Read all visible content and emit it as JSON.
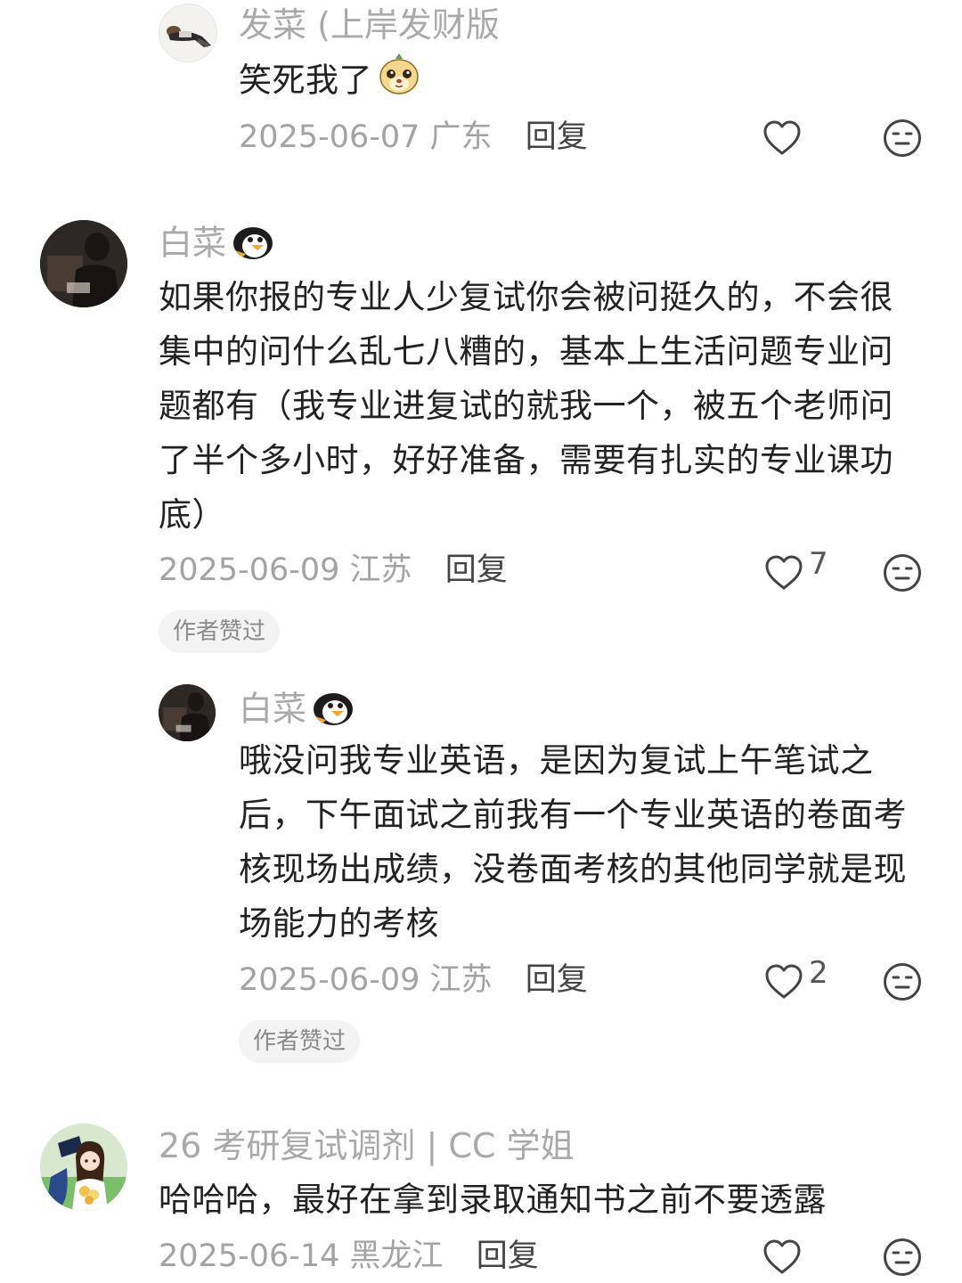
{
  "comments": [
    {
      "username": "发菜 (上岸发财版",
      "content": "笑死我了",
      "date": "2025-06-07",
      "location": "广东",
      "reply_label": "回复",
      "like_count": "",
      "emoji": "cute-sticker-icon"
    },
    {
      "username": "白菜",
      "content": "如果你报的专业人少复试你会被问挺久的，不会很集中的问什么乱七八糟的，基本上生活问题专业问题都有（我专业进复试的就我一个，被五个老师问了半个多小时，好好准备，需要有扎实的专业课功底）",
      "date": "2025-06-09",
      "location": "江苏",
      "reply_label": "回复",
      "like_count": "7",
      "badge": "作者赞过",
      "emoji": "penguin-icon"
    },
    {
      "username": "白菜",
      "content": "哦没问我专业英语，是因为复试上午笔试之后，下午面试之前我有一个专业英语的卷面考核现场出成绩，没卷面考核的其他同学就是现场能力的考核",
      "date": "2025-06-09",
      "location": "江苏",
      "reply_label": "回复",
      "like_count": "2",
      "badge": "作者赞过",
      "emoji": "penguin-icon"
    },
    {
      "username": "26 考研复试调剂 | CC 学姐",
      "content": "哈哈哈，最好在拿到录取通知书之前不要透露",
      "date": "2025-06-14",
      "location": "黑龙江",
      "reply_label": "回复",
      "like_count": ""
    }
  ],
  "colors": {
    "username": "#a9a9a9",
    "content": "#222222",
    "meta": "#a3a3a3",
    "reply": "#444444",
    "badge_bg": "#f3f3f3",
    "icon": "#444444"
  }
}
